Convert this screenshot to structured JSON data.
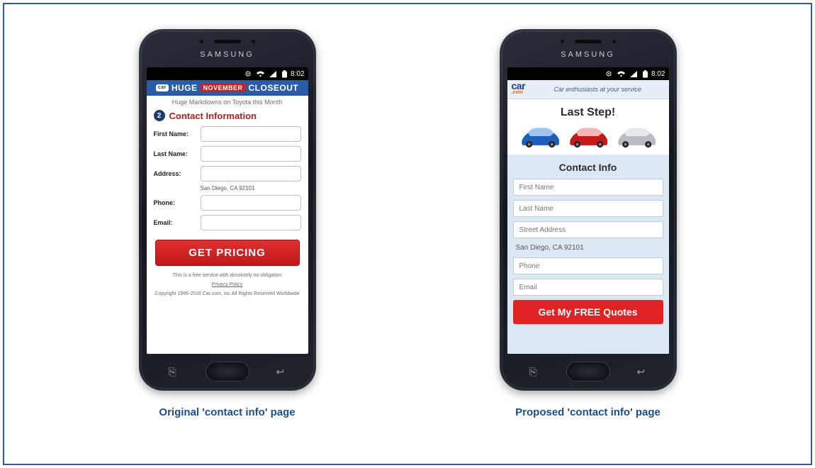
{
  "statusbar": {
    "time": "8:02"
  },
  "brand": "SAMSUNG",
  "original": {
    "banner": {
      "chip_text": "car",
      "left": "HUGE",
      "mid": "NOVEMBER",
      "right": "CLOSEOUT"
    },
    "subhead": "Huge Markdowns on Toyota this Month",
    "step_number": "2",
    "heading": "Contact Information",
    "labels": {
      "first": "First Name:",
      "last": "Last Name:",
      "address": "Address:",
      "phone": "Phone:",
      "email": "Email:"
    },
    "address_value": "San Diego, CA 92101",
    "cta": "GET PRICING",
    "disclaimer": "This is a free service with absolutely no obligation",
    "privacy": "Privacy Policy",
    "copyright": "Copyright 1996-2016 Car.com, Inc  All Rights Reserved Worldwide"
  },
  "proposed": {
    "logo_top": "car",
    "logo_dot": ".com",
    "tagline": "Car enthusiasts at your service",
    "title": "Last Step!",
    "card_title": "Contact Info",
    "placeholders": {
      "first": "First Name",
      "last": "Last Name",
      "street": "Street Address",
      "phone": "Phone",
      "email": "Email"
    },
    "city_state": "San Diego, CA 92101",
    "cta": "Get My FREE Quotes"
  },
  "captions": {
    "original": "Original 'contact info' page",
    "proposed": "Proposed 'contact info' page"
  }
}
